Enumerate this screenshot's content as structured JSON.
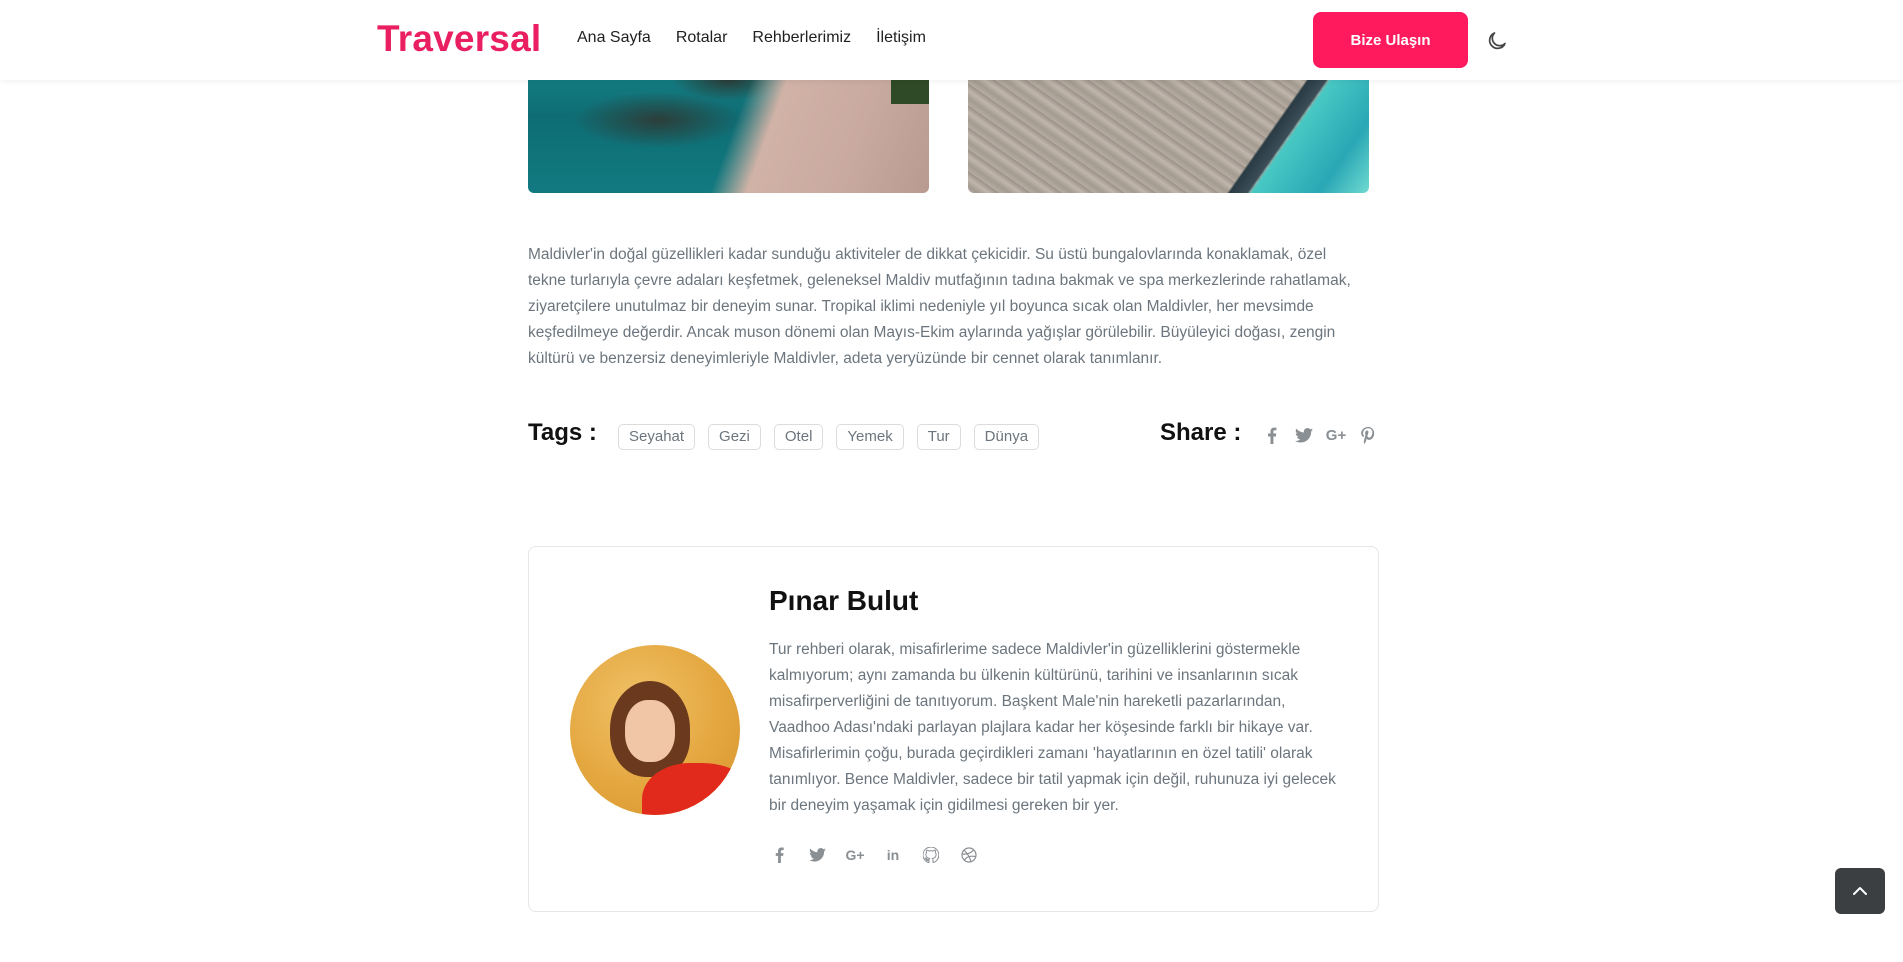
{
  "header": {
    "logo": "Traversal",
    "nav": [
      "Ana Sayfa",
      "Rotalar",
      "Rehberlerimiz",
      "İletişim"
    ],
    "cta_label": "Bize Ulaşın",
    "theme_icon": "moon-icon"
  },
  "article": {
    "paragraph": "Maldivler'in doğal güzellikleri kadar sunduğu aktiviteler de dikkat çekicidir. Su üstü bungalovlarında konaklamak, özel tekne turlarıyla çevre adaları keşfetmek, geleneksel Maldiv mutfağının tadına bakmak ve spa merkezlerinde rahatlamak, ziyaretçilere unutulmaz bir deneyim sunar. Tropikal iklimi nedeniyle yıl boyunca sıcak olan Maldivler, her mevsimde keşfedilmeye değerdir. Ancak muson dönemi olan Mayıs-Ekim aylarında yağışlar görülebilir. Büyüleyici doğası, zengin kültürü ve benzersiz deneyimleriyle Maldivler, adeta yeryüzünde bir cennet olarak tanımlanır."
  },
  "tags": {
    "title": "Tags :",
    "items": [
      "Seyahat",
      "Gezi",
      "Otel",
      "Yemek",
      "Tur",
      "Dünya"
    ]
  },
  "share": {
    "title": "Share :",
    "icons": [
      "facebook-icon",
      "twitter-icon",
      "google-plus-icon",
      "pinterest-icon"
    ]
  },
  "author": {
    "name": "Pınar Bulut",
    "bio": "Tur rehberi olarak, misafirlerime sadece Maldivler'in güzelliklerini göstermekle kalmıyorum; aynı zamanda bu ülkenin kültürünü, tarihini ve insanlarının sıcak misafirperverliğini de tanıtıyorum. Başkent Male'nin hareketli pazarlarından, Vaadhoo Adası'ndaki parlayan plajlara kadar her köşesinde farklı bir hikaye var. Misafirlerimin çoğu, burada geçirdikleri zamanı 'hayatlarının en özel tatili' olarak tanımlıyor. Bence Maldivler, sadece bir tatil yapmak için değil, ruhunuza iyi gelecek bir deneyim yaşamak için gidilmesi gereken bir yer.",
    "social": [
      "facebook-icon",
      "twitter-icon",
      "google-plus-icon",
      "linkedin-icon",
      "github-icon",
      "dribbble-icon"
    ]
  },
  "colors": {
    "brand": "#ea1f61",
    "cta": "#ff1a5e",
    "muted_text": "#6c757d"
  }
}
